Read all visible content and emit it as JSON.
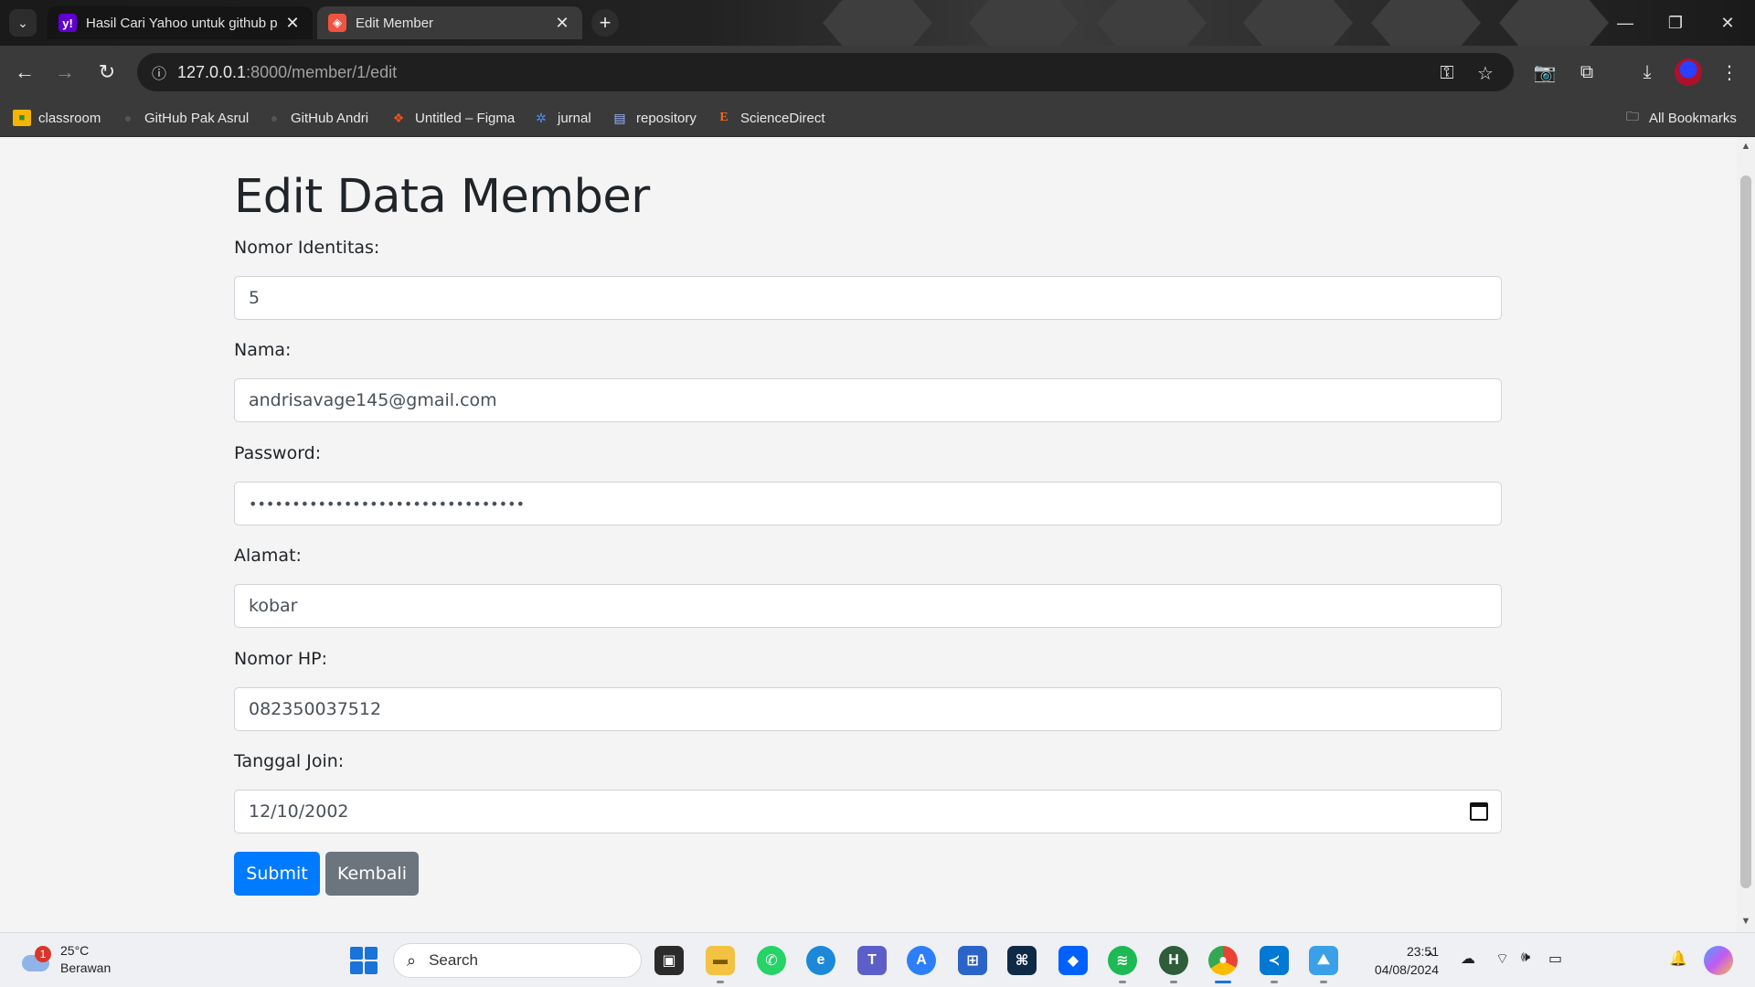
{
  "browser": {
    "tabs": [
      {
        "title": "Hasil Cari Yahoo untuk github p",
        "favicon": "yahoo-icon",
        "active": false
      },
      {
        "title": "Edit Member",
        "favicon": "laravel-icon",
        "active": true
      }
    ],
    "address": {
      "host": "127.0.0.1",
      "path": ":8000/member/1/edit"
    },
    "bookmarks": [
      {
        "label": "classroom",
        "icon": "classroom-icon"
      },
      {
        "label": "GitHub Pak Asrul",
        "icon": "github-icon"
      },
      {
        "label": "GitHub Andri",
        "icon": "github-icon"
      },
      {
        "label": "Untitled – Figma",
        "icon": "figma-icon"
      },
      {
        "label": "jurnal",
        "icon": "jurnal-icon"
      },
      {
        "label": "repository",
        "icon": "file-icon"
      },
      {
        "label": "ScienceDirect",
        "icon": "elsevier-icon"
      }
    ],
    "all_bookmarks": "All Bookmarks"
  },
  "page": {
    "title": "Edit Data Member",
    "fields": [
      {
        "label": "Nomor Identitas:",
        "value": "5",
        "type": "text"
      },
      {
        "label": "Nama:",
        "value": "andrisavage145@gmail.com",
        "type": "text"
      },
      {
        "label": "Password:",
        "value": "••••••••••••••••••••••••••••••••",
        "type": "password"
      },
      {
        "label": "Alamat:",
        "value": "kobar",
        "type": "text"
      },
      {
        "label": "Nomor HP:",
        "value": "082350037512",
        "type": "text"
      },
      {
        "label": "Tanggal Join:",
        "value": "12/10/2002",
        "type": "date"
      }
    ],
    "submit_label": "Submit",
    "back_label": "Kembali",
    "colors": {
      "primary": "#007bff",
      "secondary": "#6c757d"
    }
  },
  "taskbar": {
    "weather": {
      "temp": "25°C",
      "condition": "Berawan",
      "badge": "1"
    },
    "search_placeholder": "Search",
    "time": "23:51",
    "date": "04/08/2024"
  }
}
